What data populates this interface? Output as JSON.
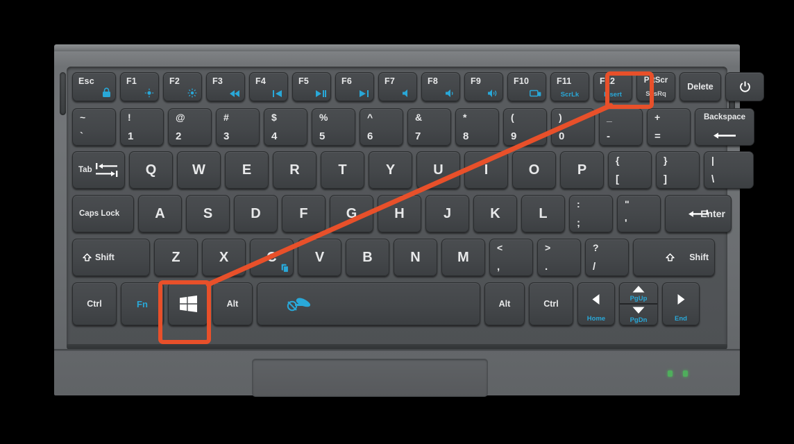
{
  "scene": {
    "device": "laptop-keyboard",
    "highlight_color": "#e8502a",
    "legend_color": "#e8e9ea",
    "fn_legend_color": "#29a8d8",
    "led_color": "#4fae5c"
  },
  "annotation": {
    "type": "arrow-connector",
    "from_key": "PrtScr",
    "to_key": "Windows",
    "highlighted_keys": [
      "PrtScr",
      "Windows"
    ]
  },
  "rows": {
    "function_row": [
      {
        "name": "esc",
        "label": "Esc",
        "fn_icon": "lock-icon"
      },
      {
        "name": "f1",
        "label": "F1",
        "fn_icon": "brightness-down-icon"
      },
      {
        "name": "f2",
        "label": "F2",
        "fn_icon": "brightness-up-icon"
      },
      {
        "name": "f3",
        "label": "F3",
        "fn_icon": "rewind-icon"
      },
      {
        "name": "f4",
        "label": "F4",
        "fn_icon": "previous-track-icon"
      },
      {
        "name": "f5",
        "label": "F5",
        "fn_icon": "play-pause-icon"
      },
      {
        "name": "f6",
        "label": "F6",
        "fn_icon": "next-track-icon"
      },
      {
        "name": "f7",
        "label": "F7",
        "fn_icon": "mute-icon"
      },
      {
        "name": "f8",
        "label": "F8",
        "fn_icon": "volume-down-icon"
      },
      {
        "name": "f9",
        "label": "F9",
        "fn_icon": "volume-up-icon"
      },
      {
        "name": "f10",
        "label": "F10",
        "fn_icon": "display-switch-icon"
      },
      {
        "name": "f11",
        "label": "F11",
        "fn_label": "ScrLk"
      },
      {
        "name": "f12",
        "label": "F12",
        "fn_label": "Insert"
      },
      {
        "name": "prtscr",
        "label": "PrtScr",
        "sub": "SysRq"
      },
      {
        "name": "delete",
        "label": "Delete"
      },
      {
        "name": "power",
        "label": "",
        "icon": "power-icon"
      }
    ],
    "number_row": [
      {
        "name": "tilde",
        "top": "~",
        "bottom": "`"
      },
      {
        "name": "key-1",
        "top": "!",
        "bottom": "1"
      },
      {
        "name": "key-2",
        "top": "@",
        "bottom": "2"
      },
      {
        "name": "key-3",
        "top": "#",
        "bottom": "3"
      },
      {
        "name": "key-4",
        "top": "$",
        "bottom": "4"
      },
      {
        "name": "key-5",
        "top": "%",
        "bottom": "5"
      },
      {
        "name": "key-6",
        "top": "^",
        "bottom": "6"
      },
      {
        "name": "key-7",
        "top": "&",
        "bottom": "7"
      },
      {
        "name": "key-8",
        "top": "*",
        "bottom": "8"
      },
      {
        "name": "key-9",
        "top": "(",
        "bottom": "9"
      },
      {
        "name": "key-0",
        "top": ")",
        "bottom": "0"
      },
      {
        "name": "minus",
        "top": "_",
        "bottom": "-"
      },
      {
        "name": "equals",
        "top": "+",
        "bottom": "="
      },
      {
        "name": "backspace",
        "label": "Backspace",
        "icon": "arrow-left-icon"
      }
    ],
    "qwerty_row": [
      {
        "name": "tab",
        "label": "Tab",
        "icon": "tab-arrows-icon"
      },
      {
        "name": "key-q",
        "label": "Q"
      },
      {
        "name": "key-w",
        "label": "W"
      },
      {
        "name": "key-e",
        "label": "E"
      },
      {
        "name": "key-r",
        "label": "R"
      },
      {
        "name": "key-t",
        "label": "T"
      },
      {
        "name": "key-y",
        "label": "Y"
      },
      {
        "name": "key-u",
        "label": "U"
      },
      {
        "name": "key-i",
        "label": "I"
      },
      {
        "name": "key-o",
        "label": "O"
      },
      {
        "name": "key-p",
        "label": "P"
      },
      {
        "name": "bracket-l",
        "top": "{",
        "bottom": "["
      },
      {
        "name": "bracket-r",
        "top": "}",
        "bottom": "]"
      },
      {
        "name": "backslash",
        "top": "|",
        "bottom": "\\"
      }
    ],
    "home_row": [
      {
        "name": "caps-lock",
        "label": "Caps Lock"
      },
      {
        "name": "key-a",
        "label": "A"
      },
      {
        "name": "key-s",
        "label": "S"
      },
      {
        "name": "key-d",
        "label": "D"
      },
      {
        "name": "key-f",
        "label": "F"
      },
      {
        "name": "key-g",
        "label": "G"
      },
      {
        "name": "key-h",
        "label": "H"
      },
      {
        "name": "key-j",
        "label": "J"
      },
      {
        "name": "key-k",
        "label": "K"
      },
      {
        "name": "key-l",
        "label": "L"
      },
      {
        "name": "semicolon",
        "top": ":",
        "bottom": ";"
      },
      {
        "name": "quote",
        "top": "\"",
        "bottom": "'"
      },
      {
        "name": "enter",
        "label": "Enter",
        "icon": "enter-arrow-icon"
      }
    ],
    "shift_row": [
      {
        "name": "shift-left",
        "label": "Shift",
        "icon": "shift-up-icon"
      },
      {
        "name": "key-z",
        "label": "Z"
      },
      {
        "name": "key-x",
        "label": "X"
      },
      {
        "name": "key-c",
        "label": "C",
        "fn_icon": "copy-blue-icon"
      },
      {
        "name": "key-v",
        "label": "V"
      },
      {
        "name": "key-b",
        "label": "B"
      },
      {
        "name": "key-n",
        "label": "N"
      },
      {
        "name": "key-m",
        "label": "M"
      },
      {
        "name": "comma",
        "top": "<",
        "bottom": ","
      },
      {
        "name": "period",
        "top": ">",
        "bottom": "."
      },
      {
        "name": "slash",
        "top": "?",
        "bottom": "/"
      },
      {
        "name": "shift-right",
        "label": "Shift",
        "icon": "shift-up-icon"
      }
    ],
    "bottom_row": [
      {
        "name": "ctrl-left",
        "label": "Ctrl"
      },
      {
        "name": "fn",
        "label": "Fn"
      },
      {
        "name": "windows",
        "label": "",
        "icon": "windows-logo-icon"
      },
      {
        "name": "alt-left",
        "label": "Alt"
      },
      {
        "name": "space",
        "label": "",
        "fn_icon": "touchpad-toggle-icon"
      },
      {
        "name": "alt-right",
        "label": "Alt"
      },
      {
        "name": "ctrl-right",
        "label": "Ctrl"
      },
      {
        "name": "arrow-left",
        "icon": "arrow-left-triangle-icon",
        "fn_label": "Home"
      },
      {
        "name": "arrow-up",
        "icon": "arrow-up-triangle-icon",
        "fn_label": "PgUp"
      },
      {
        "name": "arrow-down",
        "icon": "arrow-down-triangle-icon",
        "fn_label": "PgDn"
      },
      {
        "name": "arrow-right",
        "icon": "arrow-right-triangle-icon",
        "fn_label": "End"
      }
    ]
  },
  "indicators": {
    "led_left": "power-led",
    "led_right": "charge-led"
  }
}
